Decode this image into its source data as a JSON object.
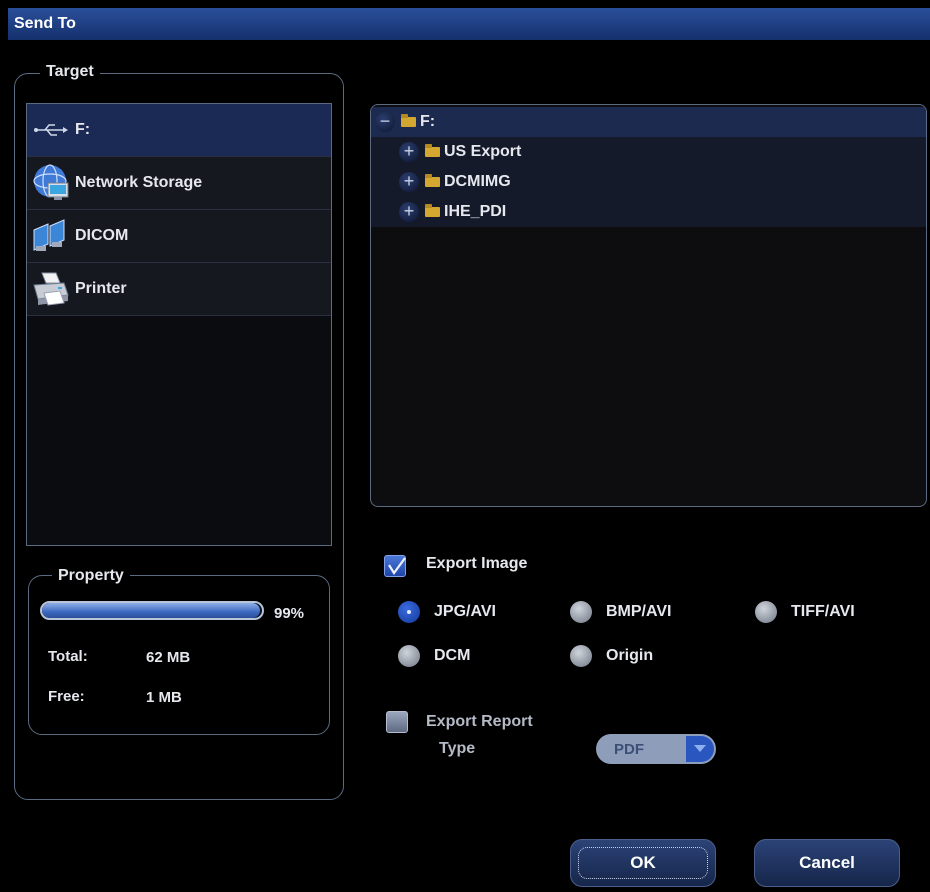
{
  "window": {
    "title": "Send To"
  },
  "target": {
    "label": "Target",
    "items": [
      {
        "label": "F:",
        "icon": "usb-icon",
        "selected": true
      },
      {
        "label": "Network Storage",
        "icon": "network-globe-icon",
        "selected": false
      },
      {
        "label": "DICOM",
        "icon": "dicom-computers-icon",
        "selected": false
      },
      {
        "label": "Printer",
        "icon": "printer-icon",
        "selected": false
      }
    ]
  },
  "property": {
    "label": "Property",
    "usage_percent": 99,
    "usage_text": "99%",
    "total_label": "Total:",
    "total_value": "62 MB",
    "free_label": "Free:",
    "free_value": "1 MB"
  },
  "tree": {
    "root": {
      "label": "F:",
      "expander": "−"
    },
    "children": [
      {
        "label": "US Export",
        "expander": "+"
      },
      {
        "label": "DCMIMG",
        "expander": "+"
      },
      {
        "label": "IHE_PDI",
        "expander": "+"
      }
    ]
  },
  "export_image": {
    "label": "Export Image",
    "checked": true,
    "formats": [
      {
        "label": "JPG/AVI",
        "checked": true
      },
      {
        "label": "BMP/AVI",
        "checked": false
      },
      {
        "label": "TIFF/AVI",
        "checked": false
      },
      {
        "label": "DCM",
        "checked": false
      },
      {
        "label": "Origin",
        "checked": false
      }
    ]
  },
  "export_report": {
    "label": "Export Report",
    "checked": false,
    "type_label": "Type",
    "type_value": "PDF"
  },
  "buttons": {
    "ok": "OK",
    "cancel": "Cancel"
  },
  "colors": {
    "title_bar": "#1f3f86",
    "selected_row": "#1a2a55",
    "accent_blue": "#2a56c0",
    "folder": "#d4a830"
  }
}
